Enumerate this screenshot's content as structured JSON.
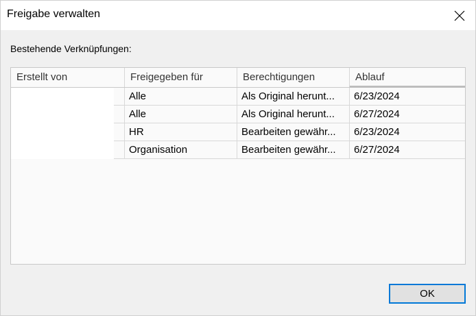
{
  "window": {
    "title": "Freigabe verwalten",
    "close_icon": "close-icon"
  },
  "section_label": "Bestehende Verknüpfungen:",
  "table": {
    "headers": [
      "Erstellt von",
      "Freigegeben für",
      "Berechtigungen",
      "Ablauf"
    ],
    "rows": [
      {
        "created_by": "",
        "shared_with": "Alle",
        "permissions": "Als Original herunt...",
        "expires": "6/23/2024"
      },
      {
        "created_by": "",
        "shared_with": "Alle",
        "permissions": "Als Original herunt...",
        "expires": "6/27/2024"
      },
      {
        "created_by": "",
        "shared_with": "HR",
        "permissions": "Bearbeiten gewähr...",
        "expires": "6/23/2024"
      },
      {
        "created_by": "",
        "shared_with": "Organisation",
        "permissions": "Bearbeiten gewähr...",
        "expires": "6/27/2024"
      }
    ]
  },
  "buttons": {
    "ok_label": "OK"
  },
  "colors": {
    "accent": "#0078d7",
    "dialog_bg": "#f0f0f0",
    "titlebar_bg": "#ffffff"
  }
}
